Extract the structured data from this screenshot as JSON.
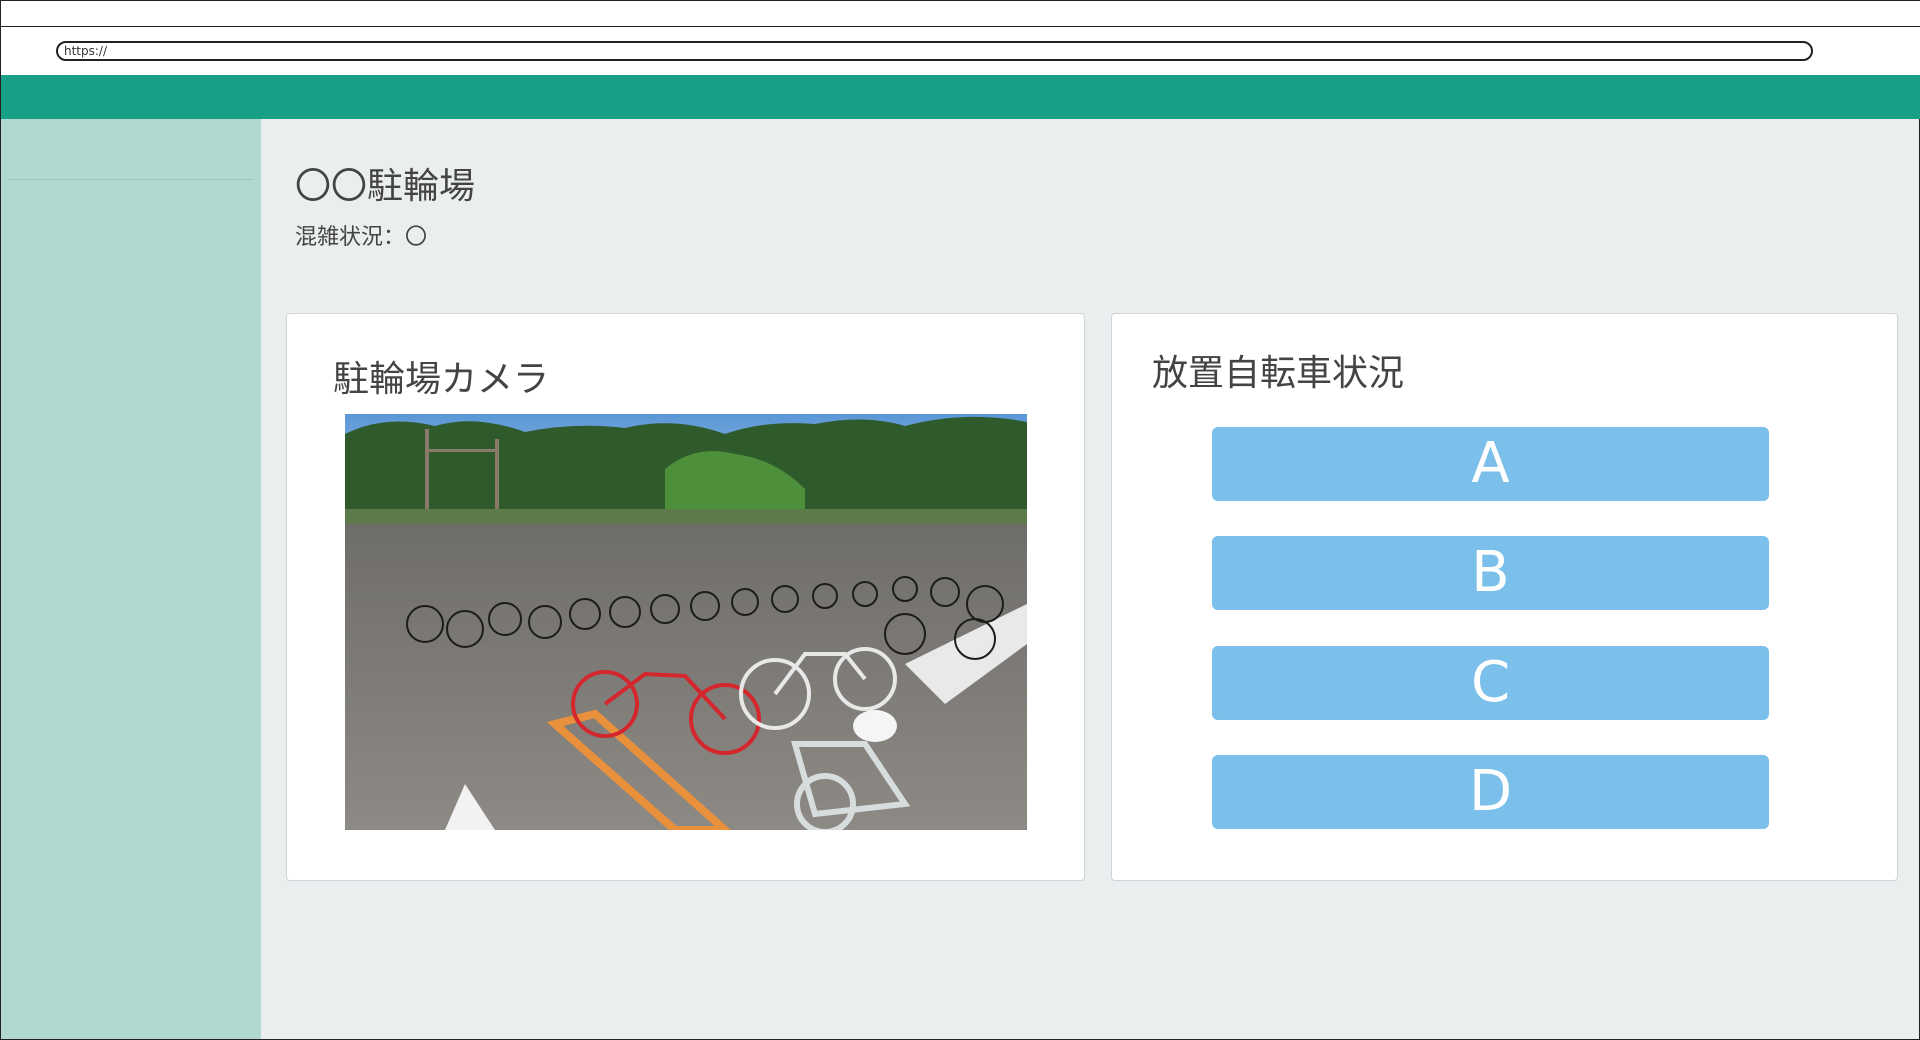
{
  "browser": {
    "url": "https://"
  },
  "page": {
    "title": "〇〇駐輪場",
    "status": "混雑状況：〇"
  },
  "camera_card": {
    "title": "駐輪場カメラ",
    "image_icon": "parking-lot-photo"
  },
  "abandoned_card": {
    "title": "放置自転車状況",
    "buttons": [
      "A",
      "B",
      "C",
      "D"
    ]
  },
  "colors": {
    "header": "#17a086",
    "sidebar": "#afd9d1",
    "background": "#ebeeef",
    "button": "#7bbfeb"
  }
}
